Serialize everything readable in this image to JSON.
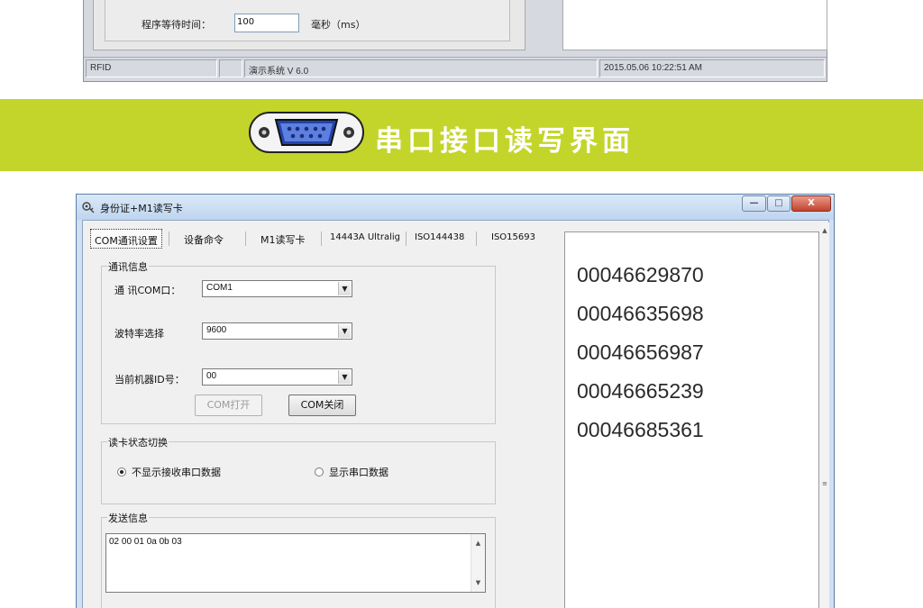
{
  "top_window": {
    "wait_label": "程序等待时间：",
    "wait_value": "100",
    "wait_unit": "毫秒（ms）",
    "statusbar": {
      "cell1": "RFID",
      "cell3": "演示系统  V 6.0",
      "cell4": "2015.05.06   10:22:51 AM"
    }
  },
  "banner": {
    "title": "串口接口读写界面",
    "icon": "serial-connector-icon"
  },
  "main_window": {
    "title": "身份证+M1读写卡",
    "controls": {
      "minimize": "—",
      "maximize": "□",
      "close": "X"
    },
    "tabs": [
      {
        "label": "COM通讯设置",
        "selected": true
      },
      {
        "label": "设备命令"
      },
      {
        "label": "M1读写卡"
      },
      {
        "label": "14443A Ultralig"
      },
      {
        "label": "ISO144438"
      },
      {
        "label": "ISO15693"
      }
    ],
    "comm_group": {
      "title": "通讯信息",
      "com_label": "通 讯COM口：",
      "com_value": "COM1",
      "baud_label": "波特率选择",
      "baud_value": "9600",
      "id_label": "当前机器ID号：",
      "id_value": "00",
      "open_button": "COM打开",
      "close_button": "COM关闭"
    },
    "status_group": {
      "title": "读卡状态切换",
      "option1": "不显示接收串口数据",
      "option2": "显示串口数据",
      "selected_option": 1
    },
    "send_group": {
      "title": "发送信息",
      "text": "02 00 01 0a 0b 03"
    },
    "output": [
      "00046629870",
      "00046635698",
      "00046656987",
      "00046665239",
      "00046685361"
    ]
  },
  "colors": {
    "banner_bg": "#c3d52a",
    "window_frame": "#cfe0f3",
    "close_button": "#c2432d"
  }
}
